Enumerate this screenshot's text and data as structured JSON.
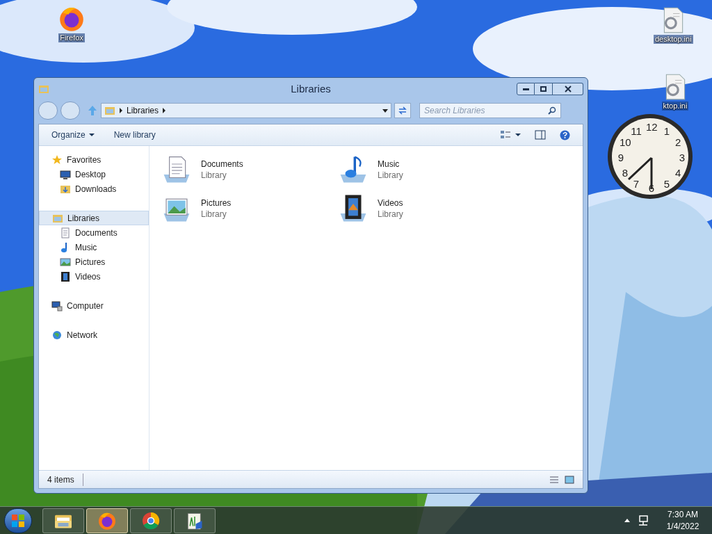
{
  "desktop_icons": [
    {
      "label": "Firefox",
      "kind": "firefox"
    },
    {
      "label": "desktop.ini",
      "kind": "file"
    },
    {
      "label": "ktop.ini",
      "kind": "file"
    }
  ],
  "clock": {
    "numerals": [
      "12",
      "11",
      "1",
      "10",
      "2",
      "9",
      "3",
      "8",
      "4",
      "7",
      "5",
      "6"
    ]
  },
  "window": {
    "title": "Libraries",
    "address": [
      "Libraries"
    ],
    "search": {
      "placeholder": "Search Libraries"
    },
    "toolbar": [
      {
        "label": "Organize",
        "dropdown": true
      },
      {
        "label": "New library",
        "dropdown": false
      }
    ],
    "nav": [
      {
        "label": "Favorites",
        "kind": "star",
        "selected": false,
        "children": [
          {
            "label": "Desktop",
            "kind": "desktop",
            "selected": false
          },
          {
            "label": "Downloads",
            "kind": "downloads",
            "selected": false
          }
        ]
      },
      {
        "label": "Libraries",
        "kind": "library",
        "selected": true,
        "children": [
          {
            "label": "Documents",
            "kind": "documents",
            "selected": false
          },
          {
            "label": "Music",
            "kind": "music",
            "selected": false
          },
          {
            "label": "Pictures",
            "kind": "pictures",
            "selected": false
          },
          {
            "label": "Videos",
            "kind": "videos",
            "selected": false
          }
        ]
      },
      {
        "label": "Computer",
        "kind": "computer",
        "selected": false
      },
      {
        "label": "Network",
        "kind": "network",
        "selected": false
      }
    ],
    "items": [
      {
        "name": "Documents",
        "type": "Library",
        "kind": "documents"
      },
      {
        "name": "Music",
        "type": "Library",
        "kind": "music"
      },
      {
        "name": "Pictures",
        "type": "Library",
        "kind": "pictures"
      },
      {
        "name": "Videos",
        "type": "Library",
        "kind": "videos"
      }
    ],
    "status": "4 items"
  },
  "taskbar": {
    "apps": [
      {
        "kind": "explorer",
        "selected": false
      },
      {
        "kind": "firefox",
        "selected": true
      },
      {
        "kind": "chrome",
        "selected": false
      },
      {
        "kind": "notepad",
        "selected": false
      }
    ],
    "time": "7:30 AM",
    "date": "1/4/2022"
  }
}
